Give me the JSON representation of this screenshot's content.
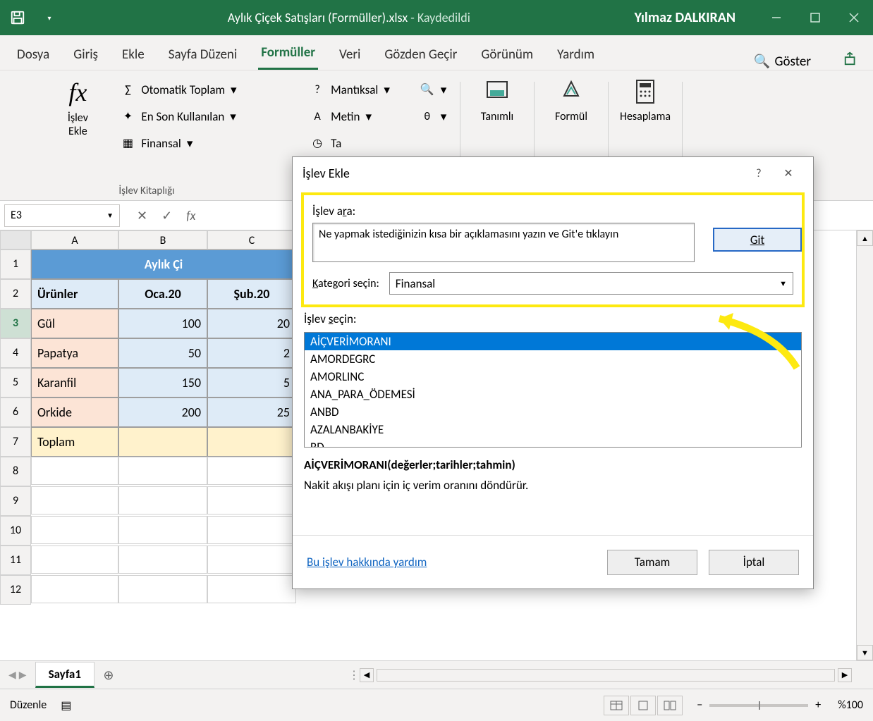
{
  "titlebar": {
    "filename": "Aylık Çiçek Satışları (Formüller).xlsx",
    "sep": "  -  ",
    "saved": "Kaydedildi",
    "user": "Yılmaz DALKIRAN"
  },
  "tabs": {
    "file": "Dosya",
    "home": "Giriş",
    "insert": "Ekle",
    "layout": "Sayfa Düzeni",
    "formulas": "Formüller",
    "data": "Veri",
    "review": "Gözden Geçir",
    "view": "Görünüm",
    "help": "Yardım",
    "search": "Göster"
  },
  "ribbon": {
    "insertfn": "İşlev\nEkle",
    "autosum": "Otomatik Toplam",
    "recent": "En Son Kullanılan",
    "financial": "Finansal",
    "logical": "Mantıksal",
    "text": "Metin",
    "datetime": "Ta",
    "defined": "Tanımlı",
    "audit": "Formül",
    "calc": "Hesaplama",
    "grouplabel": "İşlev Kitaplığı"
  },
  "formulabar": {
    "namebox": "E3"
  },
  "sheet": {
    "cols": [
      "A",
      "B",
      "C"
    ],
    "title": "Aylık Çi",
    "headers": [
      "Ürünler",
      "Oca.20",
      "Şub.20"
    ],
    "rows": [
      {
        "p": "Gül",
        "b": "100",
        "c": "20"
      },
      {
        "p": "Papatya",
        "b": "50",
        "c": "2"
      },
      {
        "p": "Karanfil",
        "b": "150",
        "c": "5"
      },
      {
        "p": "Orkide",
        "b": "200",
        "c": "25"
      }
    ],
    "total": "Toplam",
    "sheetname": "Sayfa1"
  },
  "statusbar": {
    "mode": "Düzenle",
    "zoom": "%100"
  },
  "dialog": {
    "title": "İşlev Ekle",
    "searchlabel": "İşlev ara:",
    "searchtext": "Ne yapmak istediğinizin kısa bir açıklamasını yazın ve Git'e tıklayın",
    "go": "Git",
    "catlabel": "Kategori seçin:",
    "category": "Finansal",
    "listlabel": "İşlev seçin:",
    "items": [
      "AİÇVERİMORANI",
      "AMORDEGRC",
      "AMORLINC",
      "ANA_PARA_ÖDEMESİ",
      "ANBD",
      "AZALANBAKİYE",
      "BD"
    ],
    "signature": "AİÇVERİMORANI(değerler;tarihler;tahmin)",
    "description": "Nakit akışı planı için iç verim oranını döndürür.",
    "help": "Bu işlev hakkında yardım",
    "ok": "Tamam",
    "cancel": "İptal"
  }
}
